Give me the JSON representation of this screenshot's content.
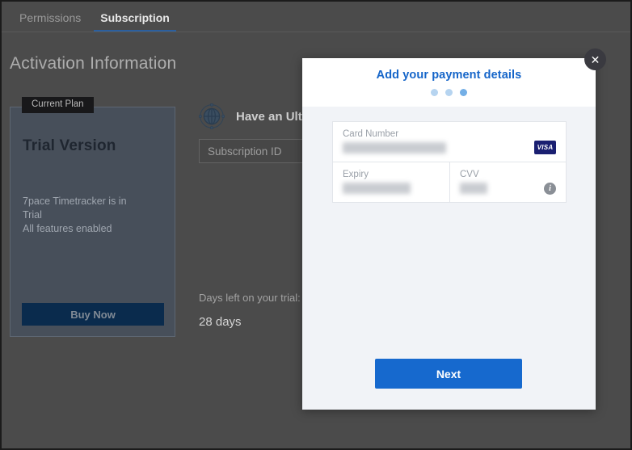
{
  "tabs": [
    {
      "label": "Permissions",
      "active": false
    },
    {
      "label": "Subscription",
      "active": true
    }
  ],
  "page": {
    "title": "Activation Information"
  },
  "plan_card": {
    "badge": "Current Plan",
    "name": "Trial Version",
    "description": "7pace Timetracker is in Trial\nAll features enabled",
    "description_line1": "7pace Timetracker is in",
    "description_line2": "Trial",
    "description_line3": "All features enabled",
    "buy_button": "Buy Now"
  },
  "ultimate": {
    "icon": "globe-icon",
    "text": "Have an Ultim",
    "subscription_input_placeholder": "Subscription ID",
    "subscription_input_value": ""
  },
  "trial": {
    "label": "Days left on your trial:",
    "value": "28 days"
  },
  "modal": {
    "title": "Add your payment details",
    "close_label": "✕",
    "steps": {
      "total": 3,
      "current": 3
    },
    "card_form": {
      "card_number": {
        "label": "Card Number",
        "value": "",
        "redacted": true,
        "brand": "VISA"
      },
      "expiry": {
        "label": "Expiry",
        "value": "",
        "redacted": true
      },
      "cvv": {
        "label": "CVV",
        "value": "",
        "redacted": true,
        "info_icon": "info-icon"
      }
    },
    "next_button": "Next"
  },
  "colors": {
    "page_bg": "#4b4b4b",
    "accent_blue": "#1669ce",
    "title_blue": "#1565c9",
    "plan_card_bg": "#474f5a",
    "buy_button_bg": "#0a2b4d",
    "modal_bg": "#f1f3f7",
    "visa_blue": "#1a1f71"
  }
}
